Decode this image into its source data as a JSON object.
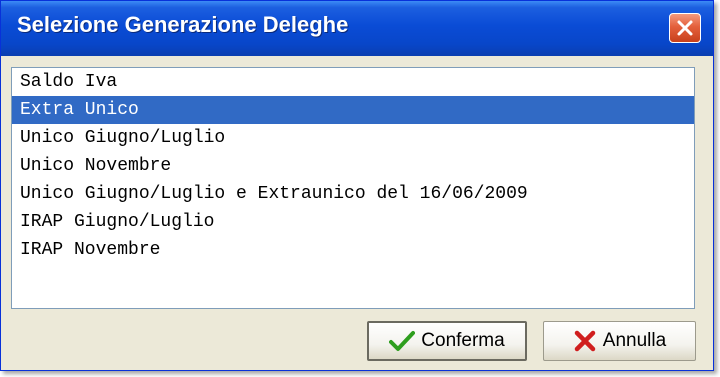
{
  "window": {
    "title": "Selezione Generazione Deleghe"
  },
  "list": {
    "items": [
      {
        "label": "Saldo Iva",
        "selected": false
      },
      {
        "label": "Extra Unico",
        "selected": true
      },
      {
        "label": "Unico Giugno/Luglio",
        "selected": false
      },
      {
        "label": "Unico Novembre",
        "selected": false
      },
      {
        "label": "Unico Giugno/Luglio e Extraunico del 16/06/2009",
        "selected": false
      },
      {
        "label": "IRAP Giugno/Luglio",
        "selected": false
      },
      {
        "label": "IRAP Novembre",
        "selected": false
      }
    ]
  },
  "buttons": {
    "confirm_label": "Conferma",
    "cancel_label": "Annulla"
  },
  "icons": {
    "close": "close-icon",
    "confirm": "checkmark-icon",
    "cancel": "red-x-icon"
  },
  "colors": {
    "title_bar": "#0a4cd6",
    "selection": "#316ac5",
    "close_button": "#e4603c",
    "checkmark": "#2e9e1e",
    "cancel_x": "#d01e1e"
  }
}
